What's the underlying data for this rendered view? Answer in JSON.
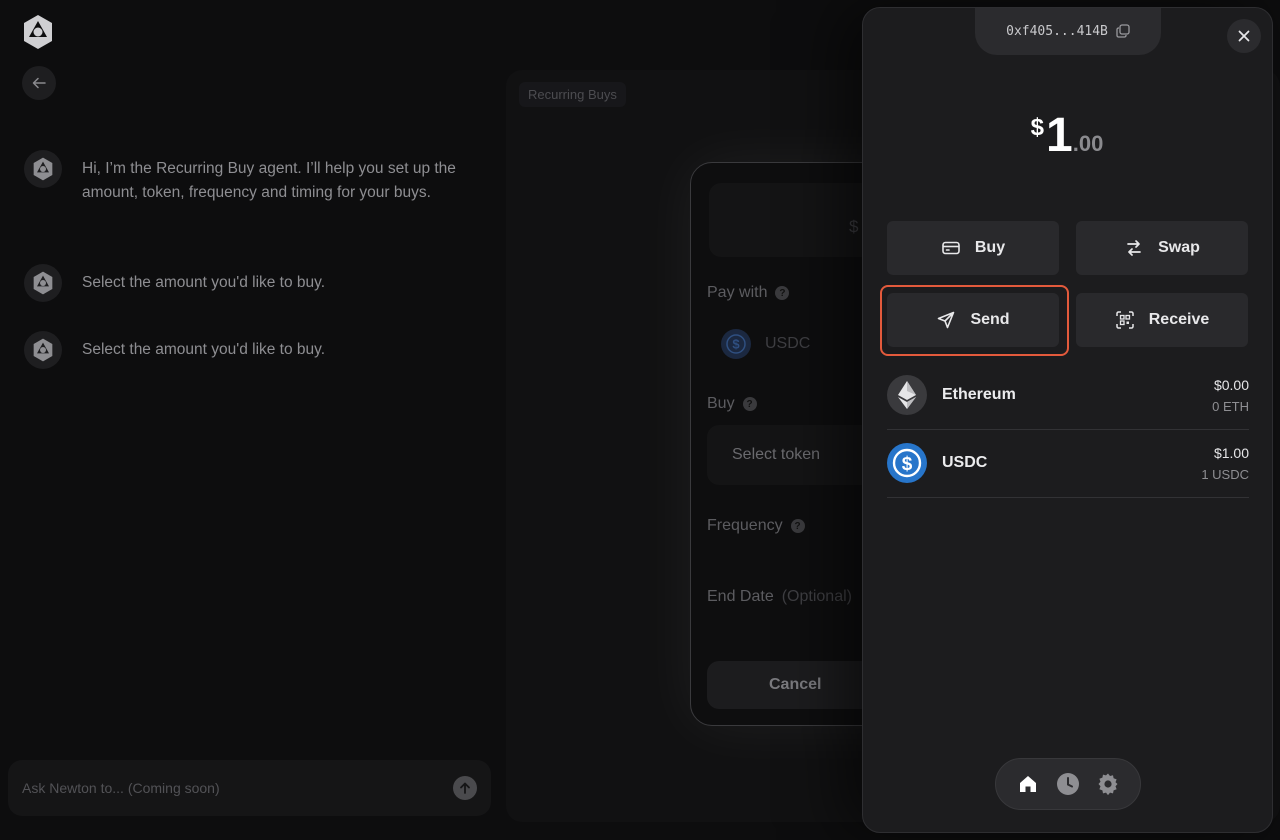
{
  "chat": {
    "messages": [
      "Hi, I’m the Recurring Buy agent. I’ll help you set up the amount, token, frequency and timing for your buys.",
      "Select the amount you'd like to buy.",
      "Select the amount you'd like to buy."
    ],
    "input_placeholder": "Ask Newton to... (Coming soon)"
  },
  "workspace": {
    "breadcrumb": "Recurring Buys"
  },
  "form": {
    "amount_symbol": "$",
    "pay_with_label": "Pay with",
    "pay_with_value": "USDC",
    "buy_label": "Buy",
    "select_token": "Select token",
    "frequency_label": "Frequency",
    "end_date_label": "End Date",
    "end_date_optional": "(Optional)",
    "cancel_label": "Cancel"
  },
  "wallet": {
    "address": "0xf405...414B",
    "balance": {
      "symbol": "$",
      "integer": "1",
      "decimal": ".00"
    },
    "actions": {
      "buy": "Buy",
      "swap": "Swap",
      "send": "Send",
      "receive": "Receive"
    },
    "highlighted_action": "send",
    "assets": [
      {
        "name": "Ethereum",
        "usd": "$0.00",
        "qty": "0 ETH",
        "icon": "ethereum-icon"
      },
      {
        "name": "USDC",
        "usd": "$1.00",
        "qty": "1 USDC",
        "icon": "usdc-icon"
      }
    ],
    "nav": [
      "home-icon",
      "history-icon",
      "settings-icon"
    ],
    "active_nav": "home-icon"
  },
  "colors": {
    "highlight": "#e35a3c",
    "usdc_blue": "#2775ca",
    "panel_bg": "#1c1c1e"
  }
}
